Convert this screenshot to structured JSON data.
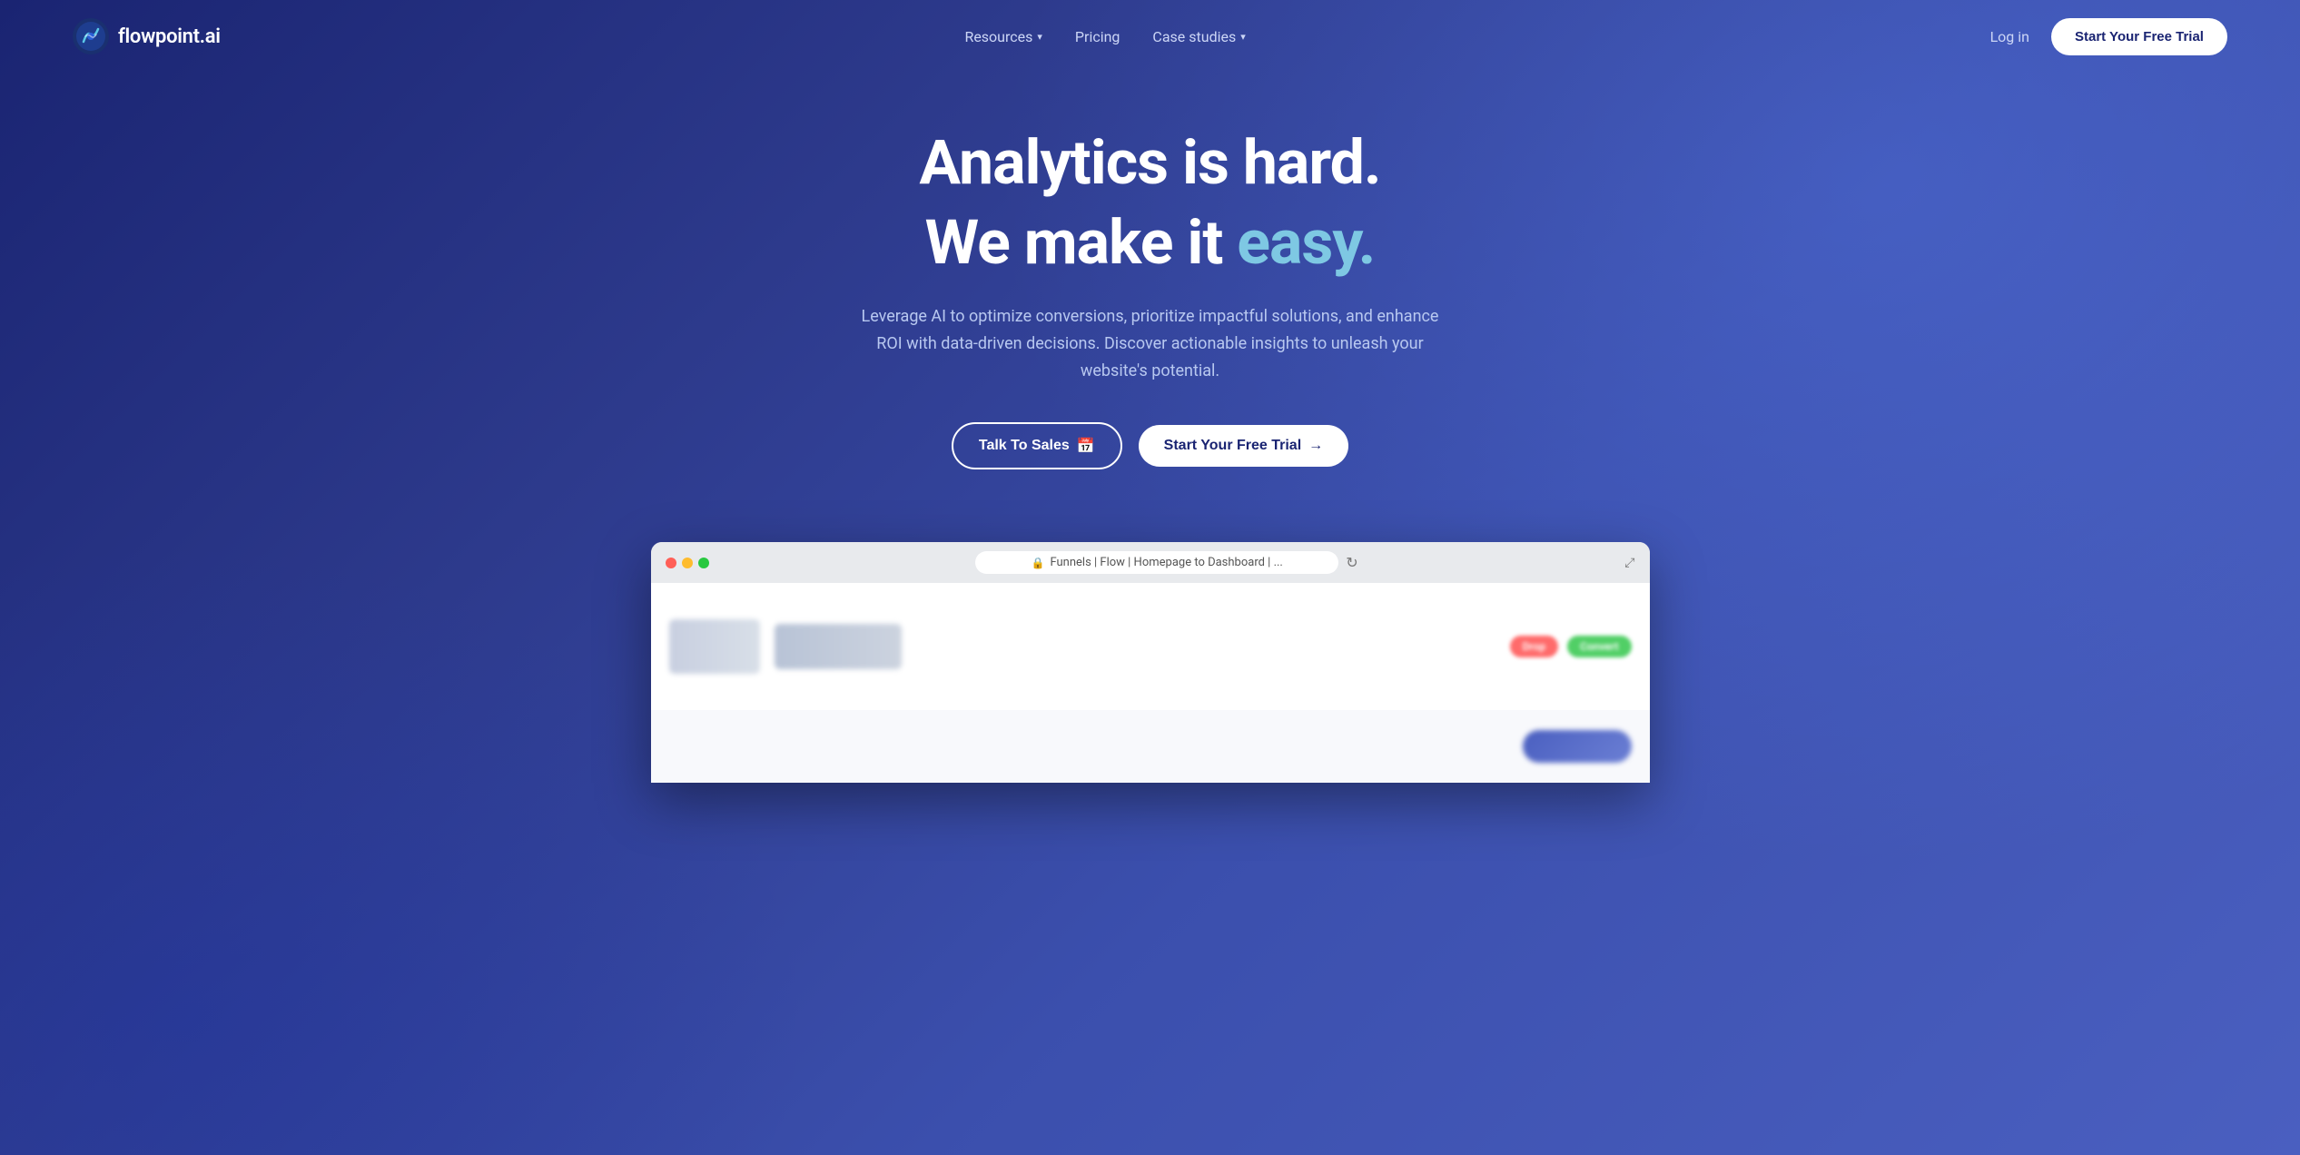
{
  "logo": {
    "text": "flowpoint.ai",
    "icon_alt": "flowpoint logo"
  },
  "nav": {
    "resources_label": "Resources",
    "pricing_label": "Pricing",
    "case_studies_label": "Case studies",
    "login_label": "Log in",
    "trial_button_label": "Start Your Free Trial"
  },
  "hero": {
    "title_line1": "Analytics is hard.",
    "title_line2_prefix": "We make it ",
    "title_line2_highlight": "easy.",
    "subtitle": "Leverage AI to optimize conversions, prioritize impactful solutions, and enhance ROI with data-driven decisions. Discover actionable insights to unleash your website's potential.",
    "btn_sales_label": "Talk To Sales",
    "btn_trial_label": "Start Your Free Trial"
  },
  "browser_mockup": {
    "address_bar_text": "Funnels | Flow | Homepage to Dashboard | ...",
    "lock_icon": "🔒",
    "reload_icon": "↻",
    "expand_icon": "⤢",
    "tag_red": "Drop",
    "tag_green": "Convert"
  }
}
